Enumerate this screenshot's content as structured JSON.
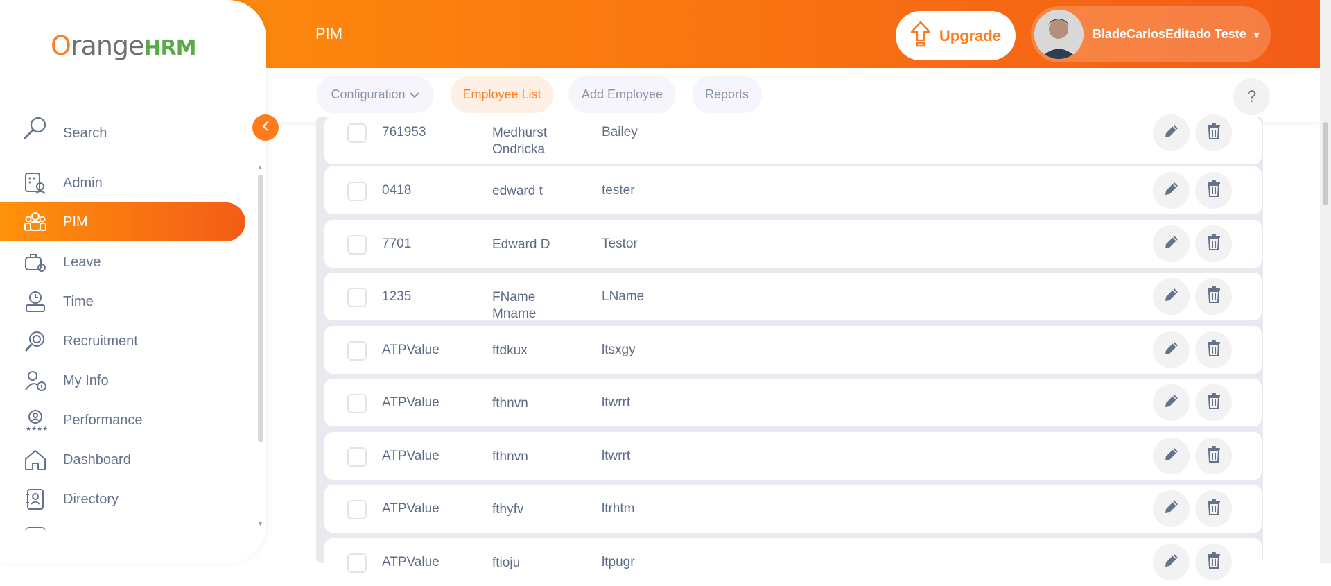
{
  "header": {
    "page_title": "PIM",
    "upgrade_label": "Upgrade",
    "user_name": "BladeCarlosEditado Teste"
  },
  "subnav": {
    "tabs": [
      {
        "label": "Configuration"
      },
      {
        "label": "Employee List"
      },
      {
        "label": "Add Employee"
      },
      {
        "label": "Reports"
      }
    ],
    "help_label": "?"
  },
  "sidebar": {
    "logo_o": "O",
    "logo_text": "range",
    "logo_hrm": "HRM",
    "search_label": "Search",
    "items": [
      {
        "label": "Admin",
        "icon": "admin-icon"
      },
      {
        "label": "PIM",
        "icon": "pim-icon"
      },
      {
        "label": "Leave",
        "icon": "leave-icon"
      },
      {
        "label": "Time",
        "icon": "time-icon"
      },
      {
        "label": "Recruitment",
        "icon": "recruitment-icon"
      },
      {
        "label": "My Info",
        "icon": "my-info-icon"
      },
      {
        "label": "Performance",
        "icon": "performance-icon"
      },
      {
        "label": "Dashboard",
        "icon": "dashboard-icon"
      },
      {
        "label": "Directory",
        "icon": "directory-icon"
      }
    ]
  },
  "table": {
    "rows": [
      {
        "id": "761953",
        "first_middle": "Medhurst Ondricka",
        "last": "Bailey"
      },
      {
        "id": "0418",
        "first_middle": "edward t",
        "last": "tester"
      },
      {
        "id": "7701",
        "first_middle": "Edward D",
        "last": "Testor"
      },
      {
        "id": "1235",
        "first_middle": "FName Mname",
        "last": "LName"
      },
      {
        "id": "ATPValue",
        "first_middle": "ftdkux",
        "last": "ltsxgy"
      },
      {
        "id": "ATPValue",
        "first_middle": "fthnvn",
        "last": "ltwrrt"
      },
      {
        "id": "ATPValue",
        "first_middle": "fthnvn",
        "last": "ltwrrt"
      },
      {
        "id": "ATPValue",
        "first_middle": "fthyfv",
        "last": "ltrhtm"
      },
      {
        "id": "ATPValue",
        "first_middle": "ftioju",
        "last": "ltpugr"
      }
    ]
  },
  "colors": {
    "brand_orange": "#ff7b1d",
    "header_gradient_start": "#ff920b",
    "header_gradient_end": "#f35c17",
    "text_gray": "#64728c"
  }
}
